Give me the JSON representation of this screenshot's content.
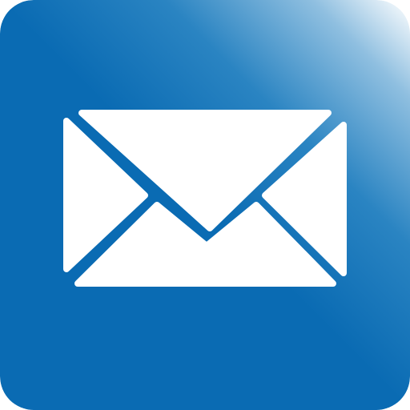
{
  "app_icon": {
    "name": "mail-app-icon",
    "glyph": "envelope-icon",
    "colors": {
      "background_dark": "#0a6bb3",
      "background_mid": "#2a84c2",
      "background_light": "#ffffff",
      "glyph": "#ffffff"
    }
  }
}
